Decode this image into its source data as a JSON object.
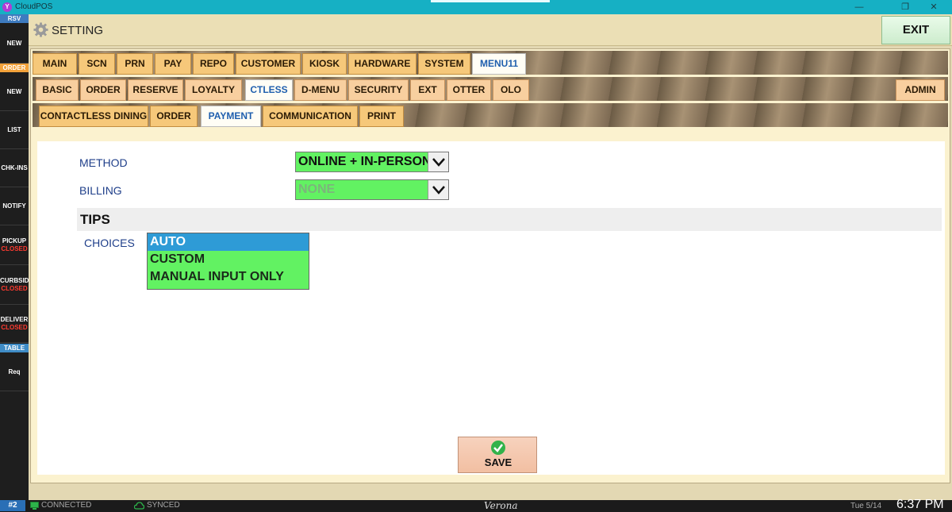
{
  "window": {
    "app_title": "CloudPOS",
    "icon_letter": "Y",
    "minimize": "—",
    "restore": "❐",
    "close": "✕"
  },
  "sidebar": {
    "rsv": "RSV",
    "items": [
      {
        "label": "NEW"
      },
      {
        "label": "NEW"
      },
      {
        "label": "LIST"
      },
      {
        "label": "CHK-INS"
      },
      {
        "label": "NOTIFY"
      },
      {
        "label": "PICKUP",
        "status": "CLOSED"
      },
      {
        "label": "CURBSID",
        "status": "CLOSED"
      },
      {
        "label": "DELIVER",
        "status": "CLOSED"
      },
      {
        "label": "Req"
      }
    ],
    "order_tag": "ORDER",
    "table_tag": "TABLE"
  },
  "header": {
    "title": "SETTING",
    "exit": "EXIT"
  },
  "tabs_level1": [
    "MAIN",
    "SCN",
    "PRN",
    "PAY",
    "REPO",
    "CUSTOMER",
    "KIOSK",
    "HARDWARE",
    "SYSTEM",
    "MENU11"
  ],
  "tabs_level2": [
    "BASIC",
    "ORDER",
    "RESERVE",
    "LOYALTY",
    "CTLESS",
    "D-MENU",
    "SECURITY",
    "EXT",
    "OTTER",
    "OLO"
  ],
  "admin_tab": "ADMIN",
  "tabs_level3": [
    "CONTACTLESS DINING",
    "ORDER",
    "PAYMENT",
    "COMMUNICATION",
    "PRINT"
  ],
  "form": {
    "method_label": "METHOD",
    "method_value": "ONLINE + IN-PERSON",
    "billing_label": "BILLING",
    "billing_value": "NONE",
    "tips_heading": "TIPS",
    "choices_label": "CHOICES",
    "choices": [
      "AUTO",
      "CUSTOM",
      "MANUAL INPUT ONLY"
    ],
    "selected_choice": "AUTO"
  },
  "save": "SAVE",
  "status": {
    "station": "#2",
    "connected": "CONNECTED",
    "synced": "SYNCED",
    "store": "Verona",
    "date": "Tue 5/14",
    "time": "6:37 PM"
  }
}
